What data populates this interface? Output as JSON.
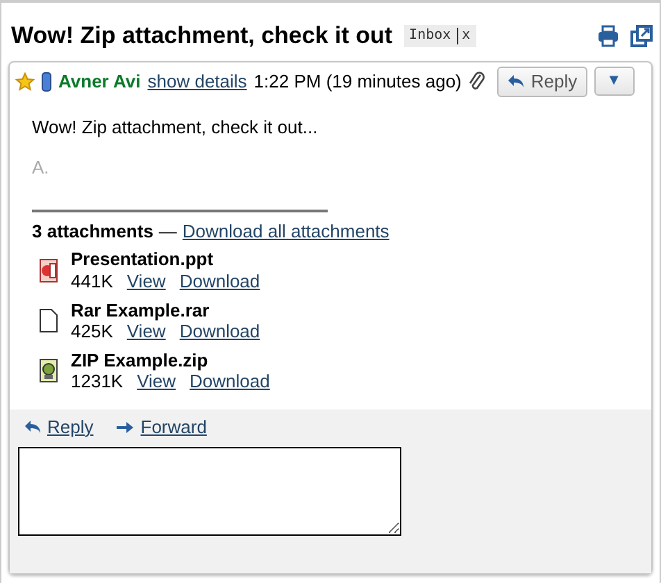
{
  "subject": "Wow! Zip attachment, check it out",
  "labels": [
    {
      "text": "Inbox",
      "remove": "x"
    }
  ],
  "message": {
    "starred": true,
    "sender": "Avner Avi",
    "details_link": "show details",
    "time": "1:22 PM (19 minutes ago)",
    "reply_button": "Reply",
    "menu_button": "▼",
    "body": [
      "Wow! Zip attachment, check it out..."
    ],
    "signature": "A.",
    "attachments_summary": {
      "count": "3 attachments",
      "separator": "—",
      "download_all": "Download all attachments"
    },
    "attachments": [
      {
        "kind": "ppt",
        "name": "Presentation.ppt",
        "size": "441K",
        "view": "View",
        "download": "Download"
      },
      {
        "kind": "generic",
        "name": "Rar Example.rar",
        "size": "425K",
        "view": "View",
        "download": "Download"
      },
      {
        "kind": "zip",
        "name": "ZIP Example.zip",
        "size": "1231K",
        "view": "View",
        "download": "Download"
      }
    ]
  },
  "footer": {
    "reply": "Reply",
    "forward": "Forward"
  }
}
